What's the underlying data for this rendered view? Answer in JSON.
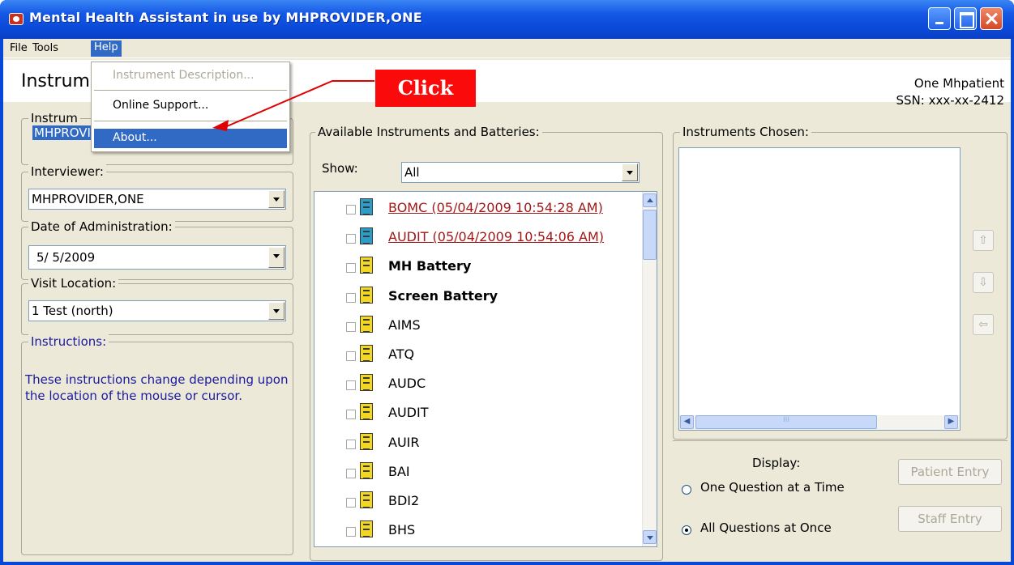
{
  "window": {
    "title": "Mental Health Assistant in use by MHPROVIDER,ONE"
  },
  "menu": {
    "file": "File",
    "tools": "Tools",
    "help": "Help"
  },
  "help_menu": {
    "items": [
      "Instrument Description...",
      "Online Support...",
      "About..."
    ]
  },
  "header": {
    "title": "Instrum",
    "patient_name": "One Mhpatient",
    "patient_ssn": "SSN: xxx-xx-2412"
  },
  "left": {
    "instrument_label": "Instrum",
    "instrument_value": "MHPROVIDER,ONE",
    "interviewer_label": "Interviewer:",
    "interviewer_value": "MHPROVIDER,ONE",
    "date_label": "Date of Administration:",
    "date_value": "5/ 5/2009",
    "location_label": "Visit Location:",
    "location_value": "1 Test (north)",
    "instructions_label": "Instructions:",
    "instructions_text": " These instructions change depending upon the location of the mouse or cursor."
  },
  "available": {
    "label": "Available Instruments and Batteries:",
    "show_label": "Show:",
    "show_value": "All",
    "items": [
      {
        "label": "BOMC  (05/04/2009 10:54:28 AM)",
        "kind": "recent"
      },
      {
        "label": "AUDIT  (05/04/2009 10:54:06 AM)",
        "kind": "recent"
      },
      {
        "label": "MH Battery",
        "kind": "battery"
      },
      {
        "label": "Screen Battery",
        "kind": "battery"
      },
      {
        "label": "AIMS",
        "kind": "instrument"
      },
      {
        "label": "ATQ",
        "kind": "instrument"
      },
      {
        "label": "AUDC",
        "kind": "instrument"
      },
      {
        "label": "AUDIT",
        "kind": "instrument"
      },
      {
        "label": "AUIR",
        "kind": "instrument"
      },
      {
        "label": "BAI",
        "kind": "instrument"
      },
      {
        "label": "BDI2",
        "kind": "instrument"
      },
      {
        "label": "BHS",
        "kind": "instrument"
      }
    ]
  },
  "chosen": {
    "label": "Instruments Chosen:",
    "hscroll_label": "III"
  },
  "display": {
    "label": "Display:",
    "option_one": "One Question at a Time",
    "option_all": "All Questions at Once",
    "selected": "All Questions at Once"
  },
  "buttons": {
    "patient_entry": "Patient Entry",
    "staff_entry": "Staff Entry"
  },
  "side_buttons": {
    "up": "⇧",
    "down": "⇩",
    "left": "⇦"
  },
  "annotation": {
    "label": "Click"
  },
  "colors": {
    "accent": "#316ac5",
    "titlebar": "#0a47d6",
    "callout": "#fa0a0a",
    "recent_link": "#a01818",
    "instructions": "#1a1aa0"
  }
}
